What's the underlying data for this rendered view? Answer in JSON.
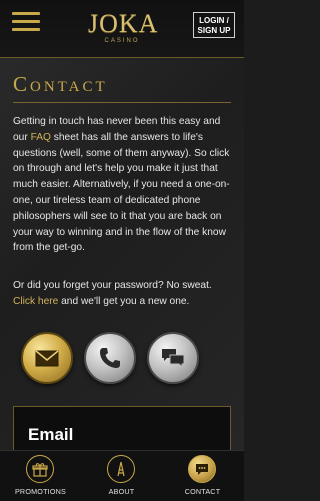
{
  "header": {
    "logo_main": "JOKA",
    "logo_sub": "CASINO",
    "login_line1": "LOGIN /",
    "login_line2": "SIGN UP"
  },
  "page": {
    "title": "Contact",
    "para1_a": "Getting in touch has never been this easy and our ",
    "para1_link": "FAQ",
    "para1_b": " sheet has all the answers to life's questions (well, some of them anyway). So click on through and let's help you make it just that much easier. Alternatively, if you need a one-on-one, our tireless team of dedicated phone philosophers will see to it that you are back on your way to winning and in the flow of the know from the get-go.",
    "para2_a": "Or did you forget your password? No sweat. ",
    "para2_link": "Click here",
    "para2_b": " and we'll get you a new one."
  },
  "contact_options": [
    {
      "icon": "envelope-icon",
      "active": true
    },
    {
      "icon": "phone-icon",
      "active": false
    },
    {
      "icon": "chat-bubbles-icon",
      "active": false
    }
  ],
  "email_card": {
    "title": "Email"
  },
  "bottom_nav": [
    {
      "label": "PROMOTIONS",
      "icon": "gift-icon"
    },
    {
      "label": "ABOUT",
      "icon": "tower-icon"
    },
    {
      "label": "CONTACT",
      "icon": "chat-icon",
      "active": true
    }
  ],
  "colors": {
    "gold": "#c9a84a",
    "background": "#1c1c1c"
  }
}
